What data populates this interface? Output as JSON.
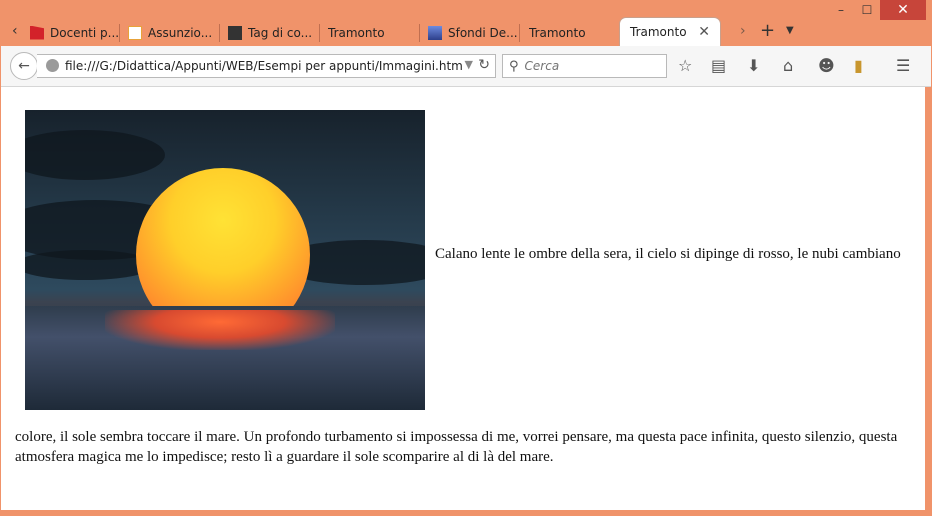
{
  "window": {
    "minimize": "–",
    "maximize": "☐",
    "close": "✕"
  },
  "tabs": [
    {
      "label": "Docenti p...",
      "favicon_color": "#d3222a"
    },
    {
      "label": "Assunzio...",
      "favicon_color": "#e8a33a"
    },
    {
      "label": "Tag di co...",
      "favicon_color": "#333333"
    },
    {
      "label": "Tramonto",
      "favicon_color": ""
    },
    {
      "label": "Sfondi De...",
      "favicon_color": "#4a6fc8"
    },
    {
      "label": "Tramonto",
      "favicon_color": ""
    },
    {
      "label": "Tramonto",
      "favicon_color": "",
      "active": true
    }
  ],
  "nav": {
    "url": "file:///G:/Didattica/Appunti/WEB/Esempi per appunti/Immagini.htm",
    "search_placeholder": "Cerca"
  },
  "page": {
    "inline_text": "Calano lente le ombre della sera, il cielo si dipinge di rosso, le nubi cambiano",
    "paragraph_rest": "colore, il sole sembra toccare il mare. Un profondo turbamento si impossessa di me, vorrei pensare, ma questa pace infinita, questo silenzio, questa atmosfera magica me lo impedisce; resto lì a guardare il sole scomparire al di là del mare."
  },
  "colors": {
    "titlebar": "#f0936a",
    "close_button": "#c7453a"
  }
}
